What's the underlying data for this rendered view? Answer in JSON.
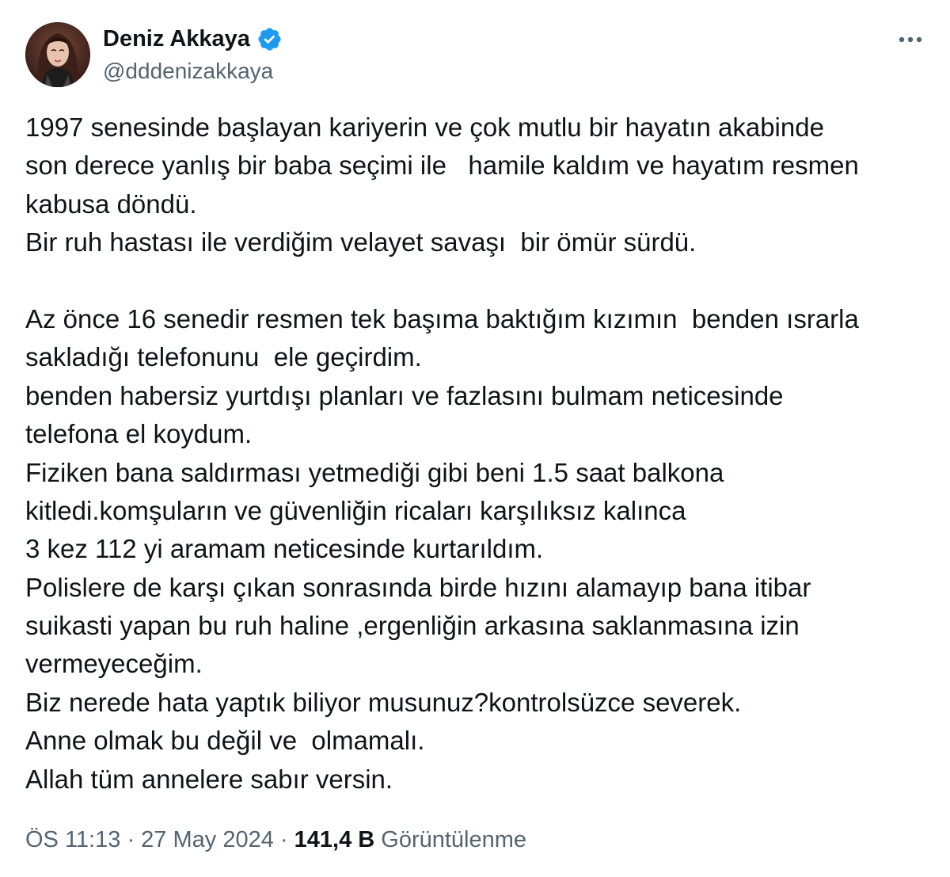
{
  "author": {
    "name": "Deniz Akkaya",
    "handle": "@dddenizakkaya",
    "verified_icon": "verified-badge-icon",
    "avatar_icon": "profile-photo",
    "verified_color": "#1d9bf0"
  },
  "menu": {
    "more_icon": "more-horizontal-icon"
  },
  "tweet": {
    "lines": [
      "1997 senesinde başlayan kariyerin ve çok mutlu bir hayatın akabinde",
      "son derece yanlış bir baba seçimi ile   hamile kaldım ve hayatım resmen",
      "kabusa döndü.",
      "Bir ruh hastası ile verdiğim velayet savaşı  bir ömür sürdü.",
      "",
      "Az önce 16 senedir resmen tek başıma baktığım kızımın  benden ısrarla",
      "sakladığı telefonunu  ele geçirdim.",
      "benden habersiz yurtdışı planları ve fazlasını bulmam neticesinde",
      "telefona el koydum.",
      "Fiziken bana saldırması yetmediği gibi beni 1.5 saat balkona",
      "kitledi.komşuların ve güvenliğin ricaları karşılıksız kalınca",
      "3 kez 112 yi aramam neticesinde kurtarıldım.",
      "Polislere de karşı çıkan sonrasında birde hızını alamayıp bana itibar",
      "suikasti yapan bu ruh haline ,ergenliğin arkasına saklanmasına izin",
      "vermeyeceğim.",
      "Biz nerede hata yaptık biliyor musunuz?kontrolsüzce severek.",
      "Anne olmak bu değil ve  olmamalı.",
      "Allah tüm annelere sabır versin."
    ]
  },
  "meta": {
    "time": "ÖS 11:13",
    "separator": " · ",
    "date": "27 May 2024",
    "views_count": "141,4 B",
    "views_label": " Görüntülenme"
  }
}
